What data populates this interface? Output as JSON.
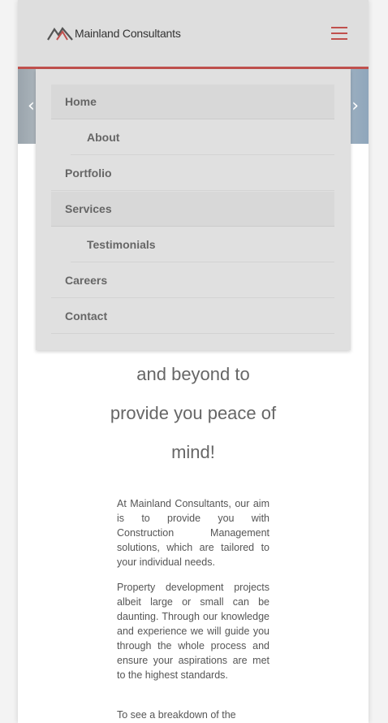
{
  "header": {
    "logo_text": "Mainland Consultants",
    "icon": "hamburger-menu-icon",
    "accent_color": "#c0504d"
  },
  "hero": {
    "prev_icon": "chevron-left-icon",
    "next_icon": "chevron-right-icon",
    "prev_glyph": "‹",
    "next_glyph": "›"
  },
  "menu": {
    "items": [
      {
        "label": "Home",
        "active": true
      },
      {
        "label": "About",
        "sub": true
      },
      {
        "label": "Portfolio"
      },
      {
        "label": "Services",
        "active": true
      },
      {
        "label": "Testimonials",
        "sub": true
      },
      {
        "label": "Careers"
      },
      {
        "label": "Contact"
      }
    ]
  },
  "content": {
    "headline_lines": [
      "and beyond to",
      "provide you peace of",
      "mind!"
    ],
    "paragraphs": [
      "At Mainland Consultants, our aim is to provide you with Construction Management solutions, which are tailored to your individual needs.",
      "Property development projects albeit large or small can be daunting. Through our knowledge and experience we will guide you through the whole process and ensure your aspirations are met to the highest standards.",
      "To see a breakdown of the"
    ]
  }
}
